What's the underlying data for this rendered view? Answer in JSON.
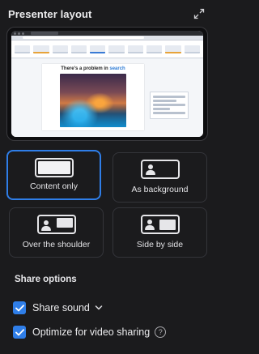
{
  "header": {
    "title": "Presenter layout",
    "expand_icon": "expand-icon"
  },
  "preview": {
    "slide_title": "There's a problem in",
    "slide_title_highlight": "search"
  },
  "layouts": [
    {
      "label": "Content only",
      "selected": true
    },
    {
      "label": "As background",
      "selected": false
    },
    {
      "label": "Over the shoulder",
      "selected": false
    },
    {
      "label": "Side by side",
      "selected": false
    }
  ],
  "share_options": {
    "title": "Share options",
    "share_sound": {
      "label": "Share sound",
      "checked": true
    },
    "optimize_video": {
      "label": "Optimize for video sharing",
      "checked": true,
      "info_glyph": "?"
    }
  },
  "colors": {
    "accent": "#2f7ee8",
    "background": "#1b1b1d"
  }
}
